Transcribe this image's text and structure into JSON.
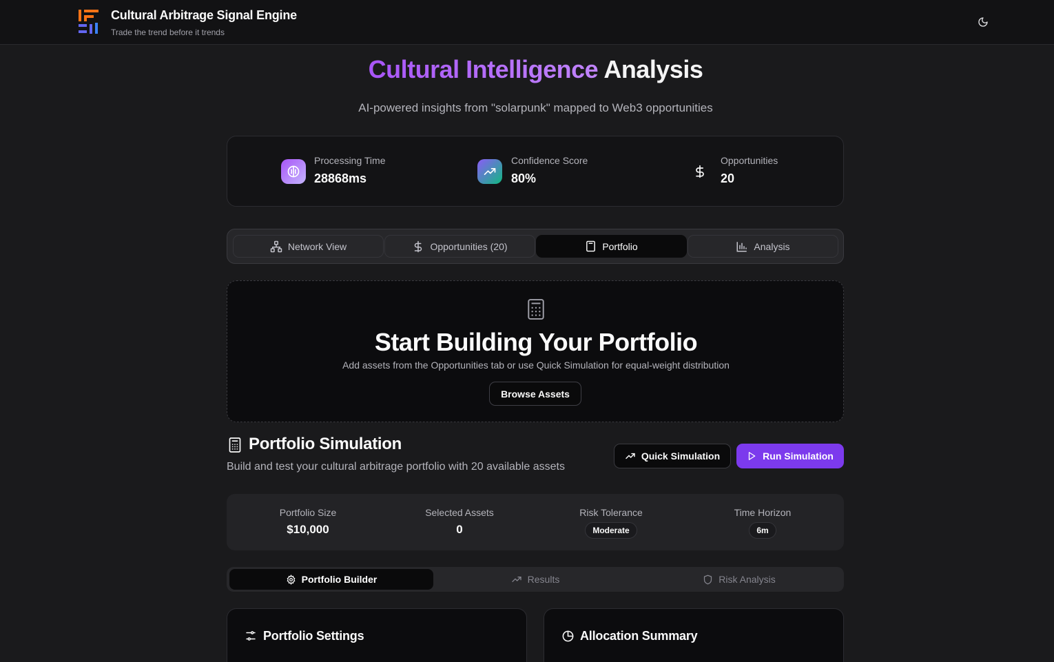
{
  "header": {
    "title": "Cultural Arbitrage Signal Engine",
    "tagline": "Trade the trend before it trends",
    "logo_icon": "logo-icon",
    "theme_toggle_icon": "moon-icon"
  },
  "hero": {
    "title_accent": "Cultural Intelligence",
    "title_rest": " Analysis",
    "subtitle": "AI-powered insights from \"solarpunk\" mapped to Web3 opportunities"
  },
  "stats": [
    {
      "label": "Processing Time",
      "value": "28868ms",
      "icon": "brain-icon"
    },
    {
      "label": "Confidence Score",
      "value": "80%",
      "icon": "trending-up-icon"
    },
    {
      "label": "Opportunities",
      "value": "20",
      "icon": "dollar-icon"
    }
  ],
  "main_tabs": [
    {
      "label": "Network View",
      "icon": "network-icon",
      "active": false
    },
    {
      "label": "Opportunities (20)",
      "icon": "dollar-icon",
      "active": false
    },
    {
      "label": "Portfolio",
      "icon": "calculator-icon",
      "active": true
    },
    {
      "label": "Analysis",
      "icon": "bar-chart-icon",
      "active": false
    }
  ],
  "empty_state": {
    "title": "Start Building Your Portfolio",
    "description": "Add assets from the Opportunities tab or use Quick Simulation for equal-weight distribution",
    "button": "Browse Assets"
  },
  "simulation": {
    "title": "Portfolio Simulation",
    "subtitle": "Build and test your cultural arbitrage portfolio with 20 available assets",
    "quick_button": "Quick Simulation",
    "run_button": "Run Simulation"
  },
  "params": [
    {
      "label": "Portfolio Size",
      "value": "$10,000"
    },
    {
      "label": "Selected Assets",
      "value": "0"
    },
    {
      "label": "Risk Tolerance",
      "value": "Moderate"
    },
    {
      "label": "Time Horizon",
      "value": "6m"
    }
  ],
  "sub_tabs": [
    {
      "label": "Portfolio Builder",
      "icon": "gear-icon",
      "active": true
    },
    {
      "label": "Results",
      "icon": "trending-up-icon",
      "active": false
    },
    {
      "label": "Risk Analysis",
      "icon": "shield-icon",
      "active": false
    }
  ],
  "panels": {
    "settings_title": "Portfolio Settings",
    "allocation_title": "Allocation Summary"
  },
  "colors": {
    "accent": "#7c3aed",
    "accent_light": "#a855f7",
    "background": "#1a1a1c"
  }
}
